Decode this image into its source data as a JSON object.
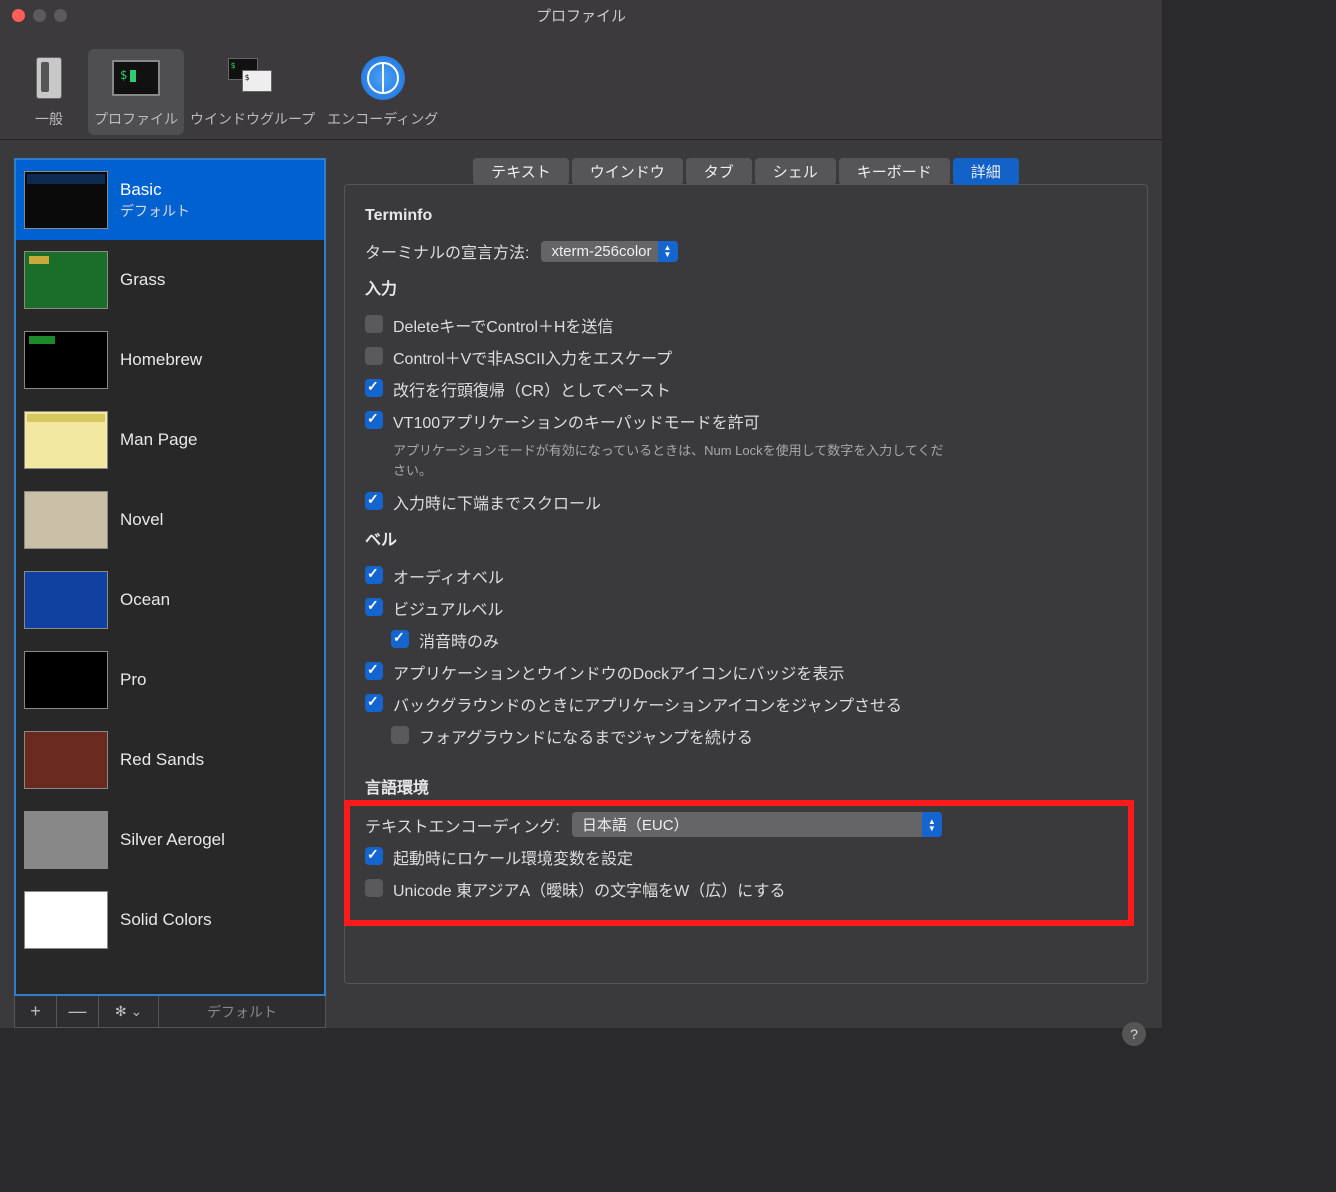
{
  "window": {
    "title": "プロファイル"
  },
  "toolbar": {
    "general": "一般",
    "profiles": "プロファイル",
    "window_groups": "ウインドウグループ",
    "encoding": "エンコーディング"
  },
  "profiles": [
    {
      "name": "Basic",
      "subtitle": "デフォルト",
      "thumb": "basic"
    },
    {
      "name": "Grass",
      "thumb": "grass"
    },
    {
      "name": "Homebrew",
      "thumb": "homebrew"
    },
    {
      "name": "Man Page",
      "thumb": "man"
    },
    {
      "name": "Novel",
      "thumb": "novel"
    },
    {
      "name": "Ocean",
      "thumb": "ocean"
    },
    {
      "name": "Pro",
      "thumb": "pro"
    },
    {
      "name": "Red Sands",
      "thumb": "red"
    },
    {
      "name": "Silver Aerogel",
      "thumb": "silver"
    },
    {
      "name": "Solid Colors",
      "thumb": "solid"
    }
  ],
  "sidebar_actions": {
    "add": "+",
    "remove": "—",
    "gear": "✻  ⌄",
    "default": "デフォルト"
  },
  "tabs": [
    "テキスト",
    "ウインドウ",
    "タブ",
    "シェル",
    "キーボード",
    "詳細"
  ],
  "selected_tab": 5,
  "sections": {
    "terminfo": {
      "heading": "Terminfo",
      "declare_label": "ターミナルの宣言方法:",
      "declare_value": "xterm-256color"
    },
    "input": {
      "heading": "入力",
      "delete_sends_ch": {
        "label": "DeleteキーでControl＋Hを送信",
        "checked": false
      },
      "ctrlv_escape": {
        "label": "Control＋Vで非ASCII入力をエスケープ",
        "checked": false
      },
      "paste_cr": {
        "label": "改行を行頭復帰（CR）としてペースト",
        "checked": true
      },
      "vt100_keypad": {
        "label": "VT100アプリケーションのキーパッドモードを許可",
        "checked": true
      },
      "vt100_hint": "アプリケーションモードが有効になっているときは、Num Lockを使用して数字を入力してください。",
      "scroll_bottom": {
        "label": "入力時に下端までスクロール",
        "checked": true
      }
    },
    "bell": {
      "heading": "ベル",
      "audio": {
        "label": "オーディオベル",
        "checked": true
      },
      "visual": {
        "label": "ビジュアルベル",
        "checked": true
      },
      "mute_only": {
        "label": "消音時のみ",
        "checked": true
      },
      "dock_badge": {
        "label": "アプリケーションとウインドウのDockアイコンにバッジを表示",
        "checked": true
      },
      "bg_bounce": {
        "label": "バックグラウンドのときにアプリケーションアイコンをジャンプさせる",
        "checked": true
      },
      "bounce_fg": {
        "label": "フォアグラウンドになるまでジャンプを続ける",
        "checked": false
      }
    },
    "locale": {
      "heading": "言語環境",
      "encoding_label": "テキストエンコーディング:",
      "encoding_value": "日本語（EUC）",
      "set_locale": {
        "label": "起動時にロケール環境変数を設定",
        "checked": true
      },
      "east_asian_w": {
        "label": "Unicode 東アジアA（曖昧）の文字幅をW（広）にする",
        "checked": false
      }
    }
  },
  "help": "?"
}
